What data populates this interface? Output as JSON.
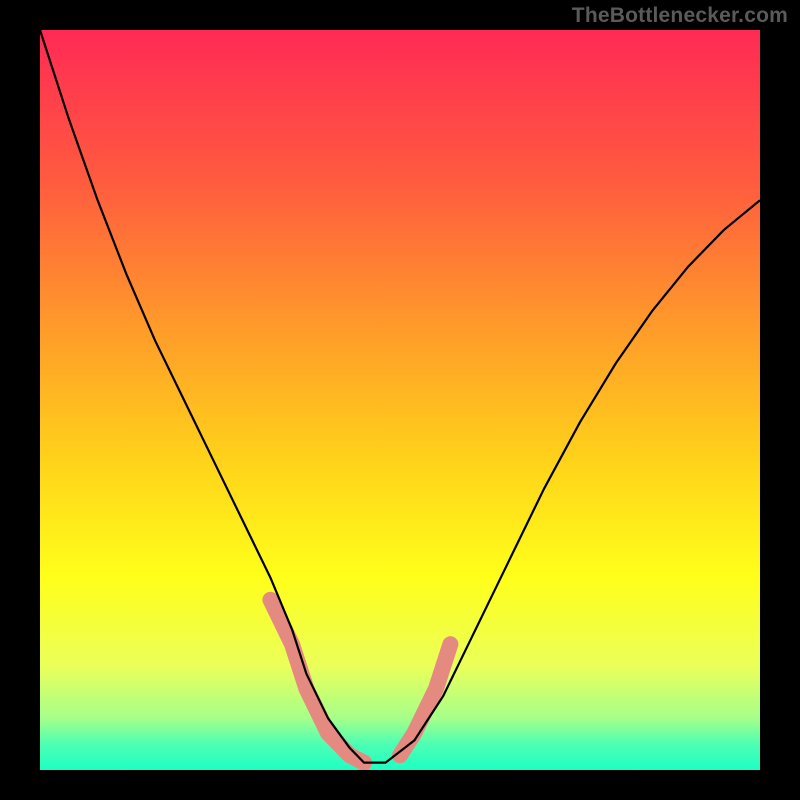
{
  "watermark": "TheBottlenecker.com",
  "chart_data": {
    "type": "line",
    "title": "",
    "xlabel": "",
    "ylabel": "",
    "xlim": [
      0,
      100
    ],
    "ylim": [
      0,
      100
    ],
    "background_gradient": {
      "type": "linear-vertical",
      "stops": [
        {
          "offset": 0.0,
          "color": "#ff2a55"
        },
        {
          "offset": 0.2,
          "color": "#ff5a3f"
        },
        {
          "offset": 0.4,
          "color": "#ff9a2a"
        },
        {
          "offset": 0.58,
          "color": "#ffd21a"
        },
        {
          "offset": 0.74,
          "color": "#ffff1a"
        },
        {
          "offset": 0.86,
          "color": "#eaff5a"
        },
        {
          "offset": 0.93,
          "color": "#a6ff8a"
        },
        {
          "offset": 0.965,
          "color": "#4dffb3"
        },
        {
          "offset": 1.0,
          "color": "#1effc4"
        }
      ]
    },
    "series": [
      {
        "name": "bottleneck_curve",
        "stroke": "#000000",
        "stroke_width": 2.2,
        "x": [
          0,
          4,
          8,
          12,
          16,
          20,
          24,
          28,
          32,
          35,
          37,
          40,
          43,
          45,
          48,
          52,
          56,
          60,
          65,
          70,
          75,
          80,
          85,
          90,
          95,
          100
        ],
        "y": [
          100,
          88,
          77,
          67,
          58,
          50,
          42,
          34,
          26,
          19,
          13,
          7,
          3,
          1,
          1,
          4,
          10,
          18,
          28,
          38,
          47,
          55,
          62,
          68,
          73,
          77
        ]
      }
    ],
    "highlight_segments": [
      {
        "name": "left_highlight",
        "stroke": "#e58a80",
        "stroke_width": 16,
        "linecap": "round",
        "x": [
          32,
          35,
          37,
          40,
          43,
          45
        ],
        "y": [
          23,
          17,
          11,
          5,
          2,
          1
        ]
      },
      {
        "name": "right_highlight",
        "stroke": "#e58a80",
        "stroke_width": 16,
        "linecap": "round",
        "x": [
          50,
          52,
          55,
          57
        ],
        "y": [
          2,
          5,
          11,
          17
        ]
      }
    ]
  }
}
